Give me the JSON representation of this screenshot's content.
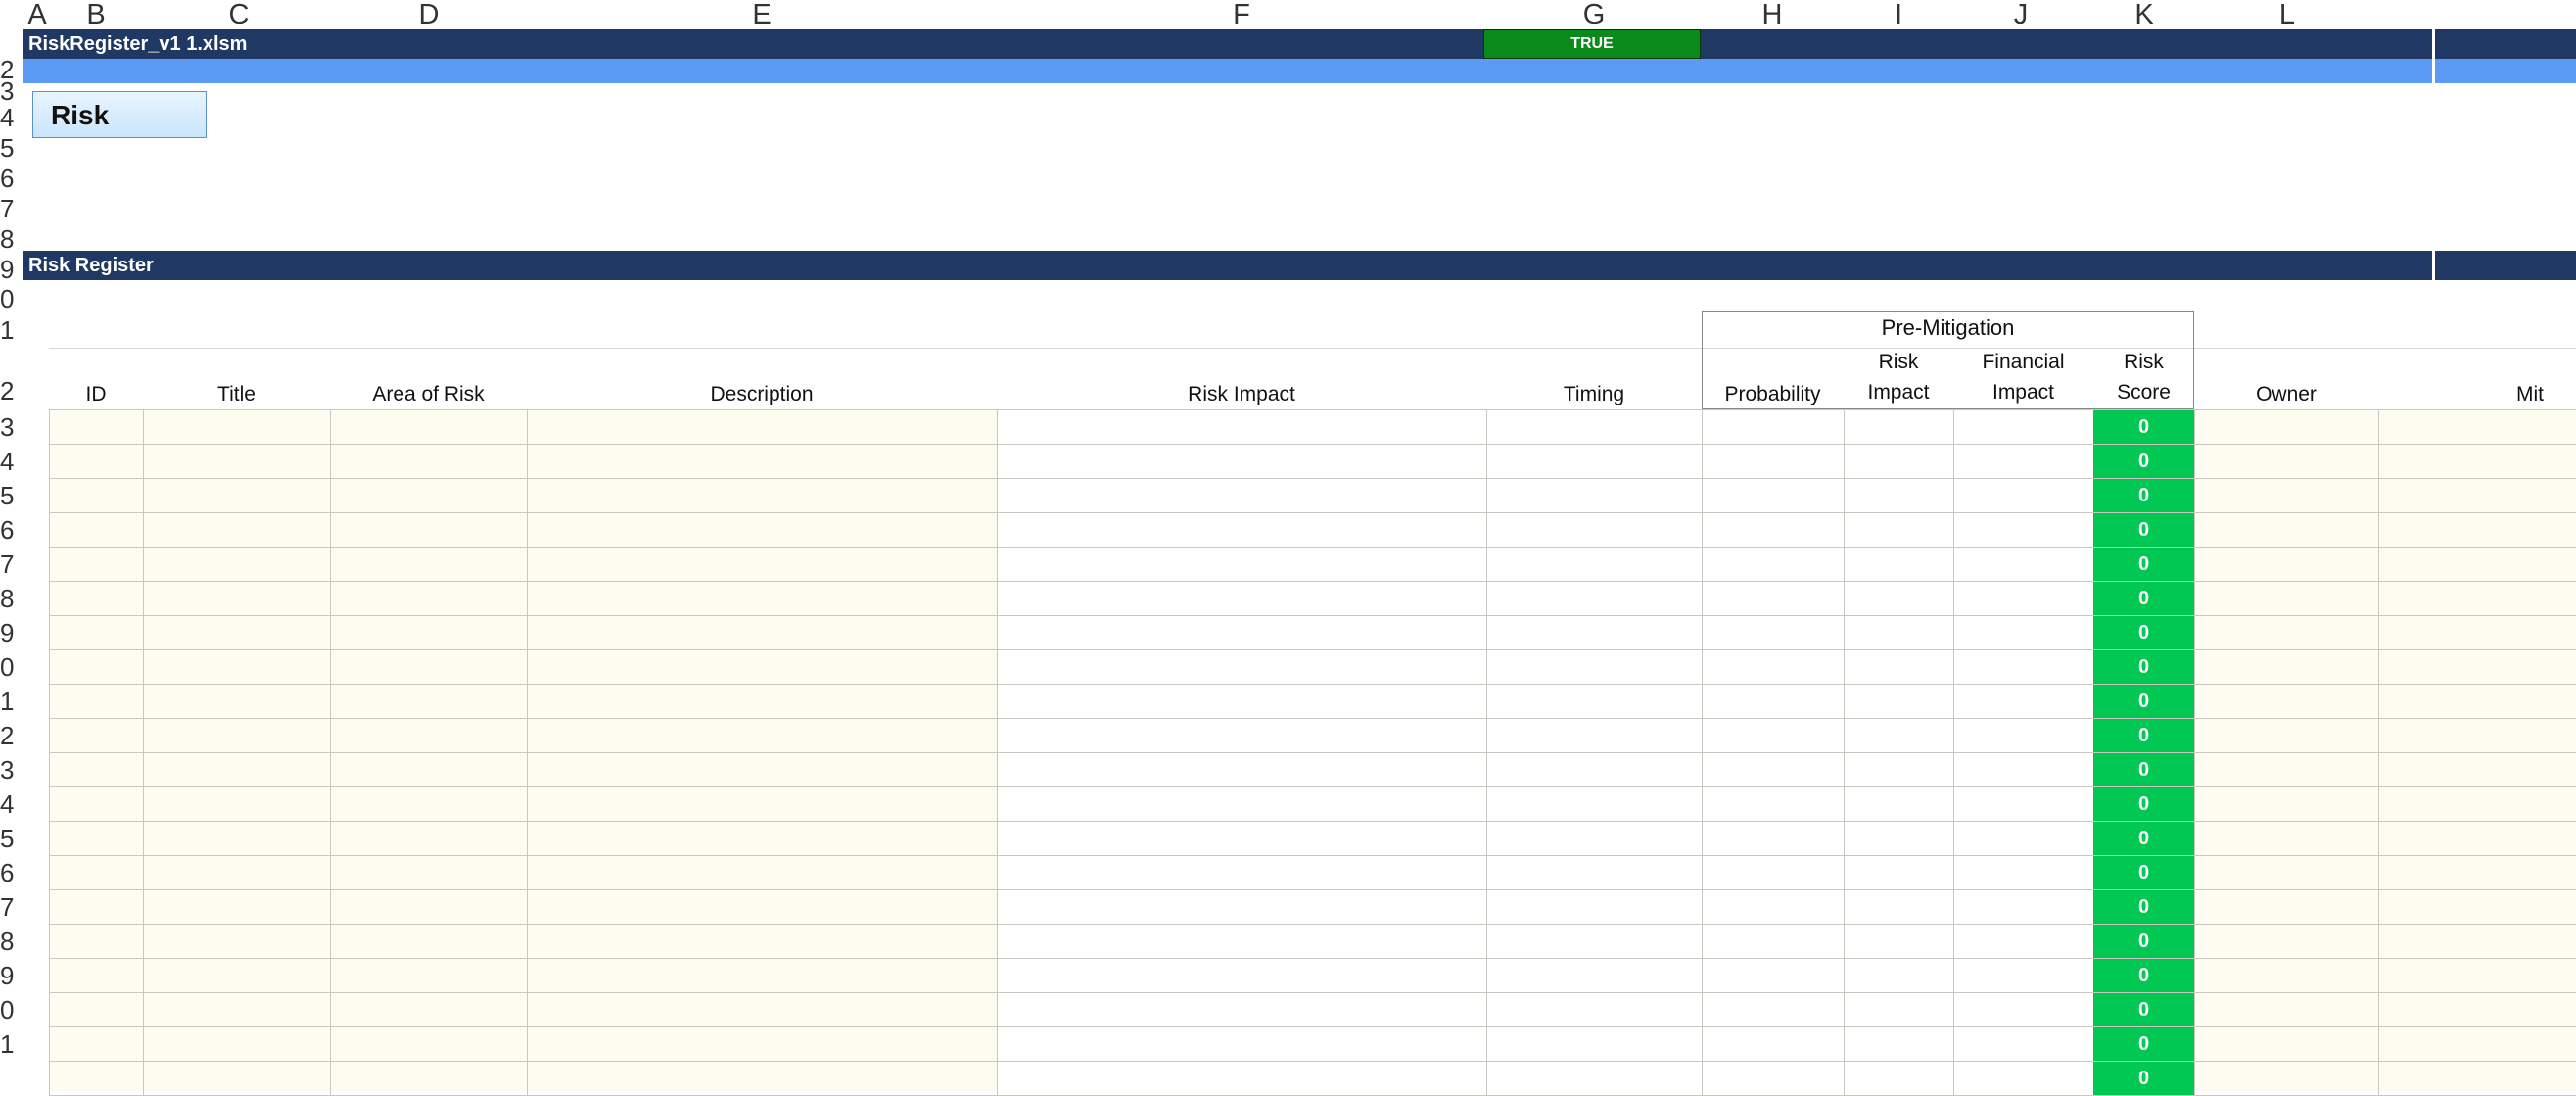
{
  "columns": [
    "A",
    "B",
    "C",
    "D",
    "E",
    "F",
    "G",
    "H",
    "I",
    "J",
    "K",
    "L"
  ],
  "row_numbers": [
    "2",
    "3",
    "4",
    "5",
    "6",
    "7",
    "8",
    "9",
    "0",
    "1",
    "2",
    "3",
    "4",
    "5",
    "6",
    "7",
    "8",
    "9",
    "0",
    "1",
    "2",
    "3",
    "4",
    "5",
    "6",
    "7",
    "8",
    "9",
    "0",
    "1"
  ],
  "workbook_title": "RiskRegister_v1 1.xlsm",
  "flag_value": "TRUE",
  "risk_button_label": "Risk",
  "section_title": "Risk Register",
  "pre_mitigation_label": "Pre-Mitigation",
  "headers": {
    "id": "ID",
    "title": "Title",
    "area": "Area of Risk",
    "description": "Description",
    "risk_impact": "Risk Impact",
    "timing": "Timing",
    "probability": "Probability",
    "risk_impact2_line1": "Risk",
    "risk_impact2_line2": "Impact",
    "financial_line1": "Financial",
    "financial_line2": "Impact",
    "score_line1": "Risk",
    "score_line2": "Score",
    "owner": "Owner",
    "mitigation_partial": "Mit"
  },
  "risk_scores": [
    "0",
    "0",
    "0",
    "0",
    "0",
    "0",
    "0",
    "0",
    "0",
    "0",
    "0",
    "0",
    "0",
    "0",
    "0",
    "0",
    "0",
    "0",
    "0",
    "0"
  ],
  "colors": {
    "dark_band": "#1f3864",
    "light_band": "#5b9bf5",
    "true_fill": "#0a8a1a",
    "score_fill": "#00c853",
    "input_cell": "#fcfcf0"
  }
}
